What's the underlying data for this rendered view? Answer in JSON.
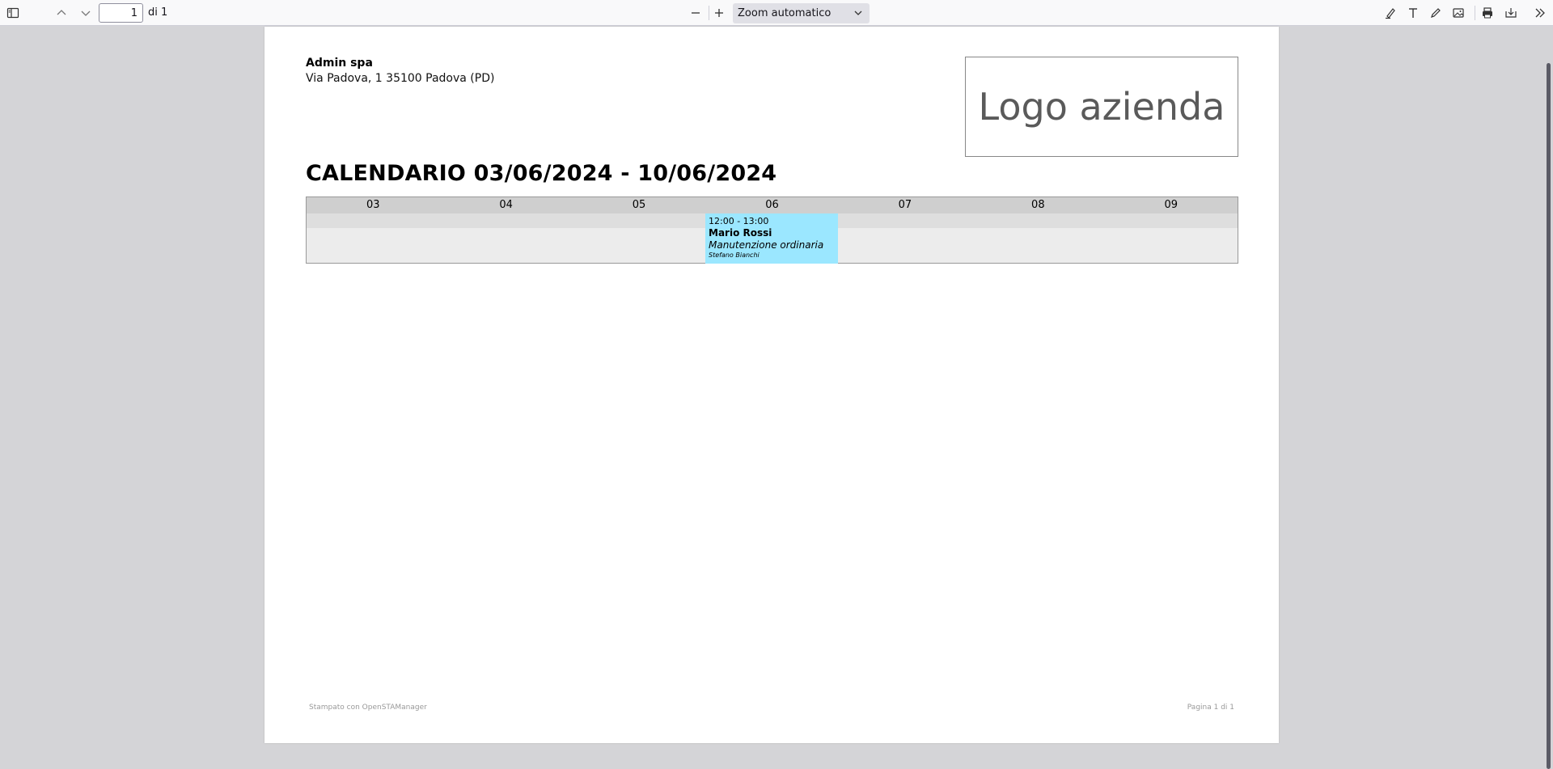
{
  "toolbar": {
    "page_current": "1",
    "page_total": "di 1",
    "zoom": "Zoom automatico"
  },
  "document": {
    "company_name": "Admin spa",
    "company_address": "Via Padova, 1 35100 Padova (PD)",
    "logo_text": "Logo azienda",
    "title": "CALENDARIO 03/06/2024 - 10/06/2024",
    "days": [
      "03",
      "04",
      "05",
      "06",
      "07",
      "08",
      "09"
    ],
    "event": {
      "time": "12:00 - 13:00",
      "client": "Mario Rossi",
      "type": "Manutenzione ordinaria",
      "technician": "Stefano Bianchi",
      "color": "#9be7ff"
    },
    "footer_left": "Stampato con OpenSTAManager",
    "footer_right": "Pagina 1 di 1"
  }
}
